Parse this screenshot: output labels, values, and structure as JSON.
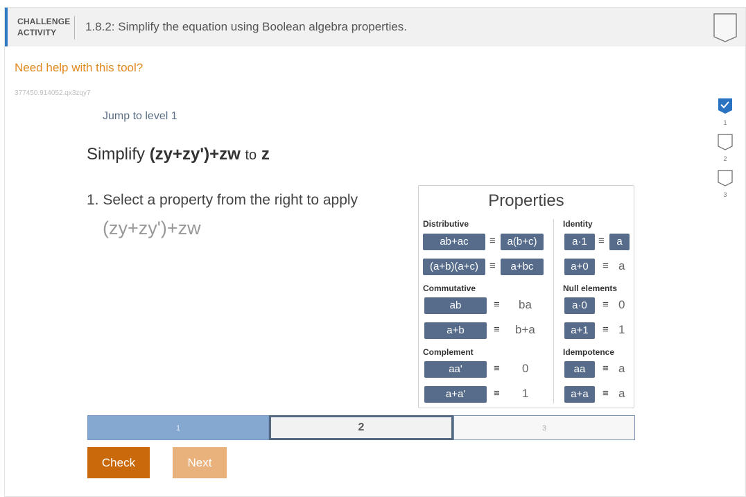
{
  "header": {
    "activity_line1": "CHALLENGE",
    "activity_line2": "ACTIVITY",
    "title": "1.8.2: Simplify the equation using Boolean algebra properties."
  },
  "help_link": "Need help with this tool?",
  "activity_id": "377450.914052.qx3zqy7",
  "jump_link": "Jump to level 1",
  "problem": {
    "prefix": "Simplify",
    "expression": "(zy+zy')+zw",
    "to": "to",
    "target": "z"
  },
  "instruction": "1. Select a property from the right to apply",
  "current_expression": "(zy+zy')+zw",
  "properties": {
    "title": "Properties",
    "equiv": "≡",
    "distributive": {
      "label": "Distributive",
      "r1_left": "ab+ac",
      "r1_right": "a(b+c)",
      "r2_left": "(a+b)(a+c)",
      "r2_right": "a+bc"
    },
    "commutative": {
      "label": "Commutative",
      "r1_left": "ab",
      "r1_right": "ba",
      "r2_left": "a+b",
      "r2_right": "b+a"
    },
    "complement": {
      "label": "Complement",
      "r1_left": "aa'",
      "r1_right": "0",
      "r2_left": "a+a'",
      "r2_right": "1"
    },
    "identity": {
      "label": "Identity",
      "r1_left": "a·1",
      "r1_right": "a",
      "r2_left": "a+0",
      "r2_right": "a"
    },
    "null_elements": {
      "label": "Null elements",
      "r1_left": "a·0",
      "r1_right": "0",
      "r2_left": "a+1",
      "r2_right": "1"
    },
    "idempotence": {
      "label": "Idempotence",
      "r1_left": "aa",
      "r1_right": "a",
      "r2_left": "a+a",
      "r2_right": "a"
    }
  },
  "levels": [
    "1",
    "2",
    "3"
  ],
  "current_level": 2,
  "side_levels": [
    {
      "num": "1",
      "status": "completed"
    },
    {
      "num": "2",
      "status": "incomplete"
    },
    {
      "num": "3",
      "status": "incomplete"
    }
  ],
  "buttons": {
    "check": "Check",
    "next": "Next"
  },
  "colors": {
    "accent": "#3279c5",
    "property_button": "#566c8a",
    "check": "#c9690b",
    "next_disabled": "#e9b27d",
    "help_link": "#e2891f",
    "level_done": "#85a8d0",
    "check_mark": "#2a73c3"
  }
}
